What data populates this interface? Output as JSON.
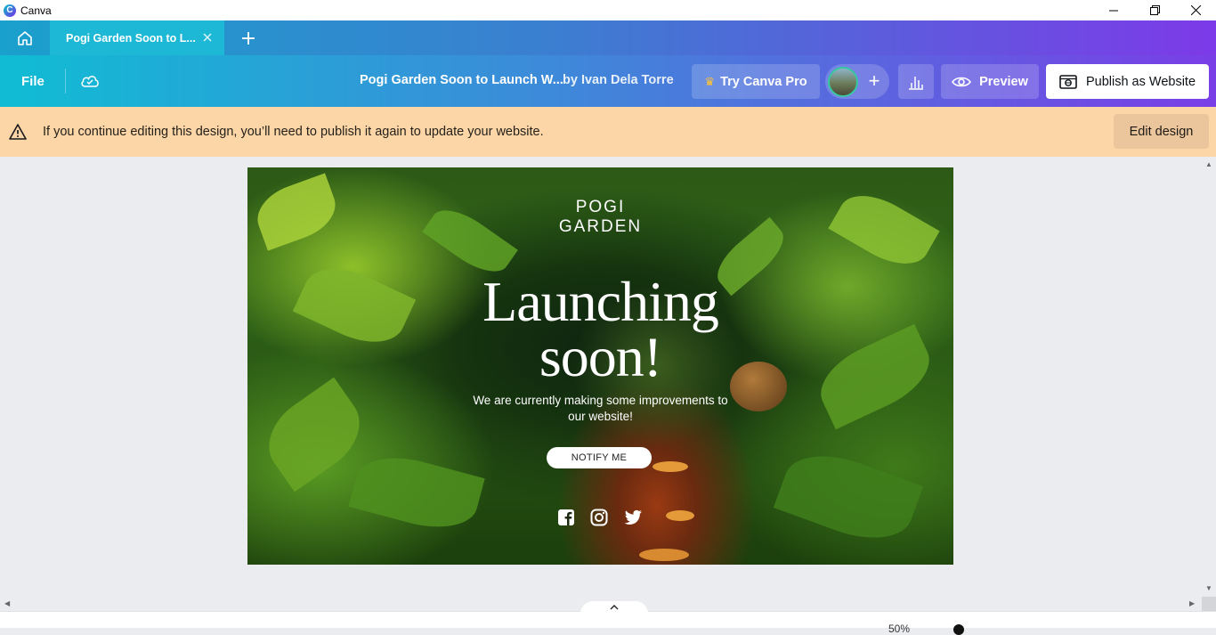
{
  "window": {
    "app_name": "Canva"
  },
  "tabs": {
    "active_title": "Pogi Garden Soon to L..."
  },
  "toolbar": {
    "file_label": "File",
    "doc_title": "Pogi Garden Soon to Launch W...",
    "doc_author": "by Ivan Dela Torre",
    "pro_label": "Try Canva Pro",
    "preview_label": "Preview",
    "publish_label": "Publish as Website"
  },
  "banner": {
    "message": "If you continue editing this design, you’ll need to publish it again to update your website.",
    "edit_label": "Edit design"
  },
  "design": {
    "brand_line1": "POGI",
    "brand_line2": "GARDEN",
    "headline_line1": "Launching",
    "headline_line2": "soon!",
    "subtext": "We are currently making some improvements to our website!",
    "notify_label": "NOTIFY ME"
  },
  "footer": {
    "zoom": "50%"
  },
  "colors": {
    "accent_start": "#10bcd4",
    "accent_end": "#7a3ee6",
    "banner_bg": "#fdd6a8"
  }
}
